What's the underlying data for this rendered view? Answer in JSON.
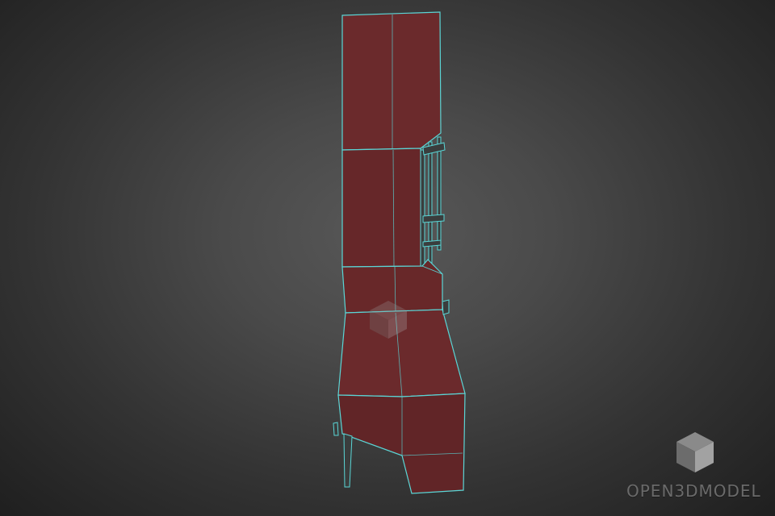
{
  "watermark": {
    "text": "OPEN3DMODEL",
    "icon": "cube-logo-icon"
  },
  "center_watermark": {
    "icon": "cube-logo-icon"
  },
  "model": {
    "description_icon": "wireframe-cabinet",
    "colors": {
      "face": "#6b2a2c",
      "face_dark": "#5a2426",
      "edge": "#5ad6d6",
      "leg": "#3a3d3d",
      "background_center": "#585858",
      "background_edge": "#1f1f1f"
    }
  }
}
